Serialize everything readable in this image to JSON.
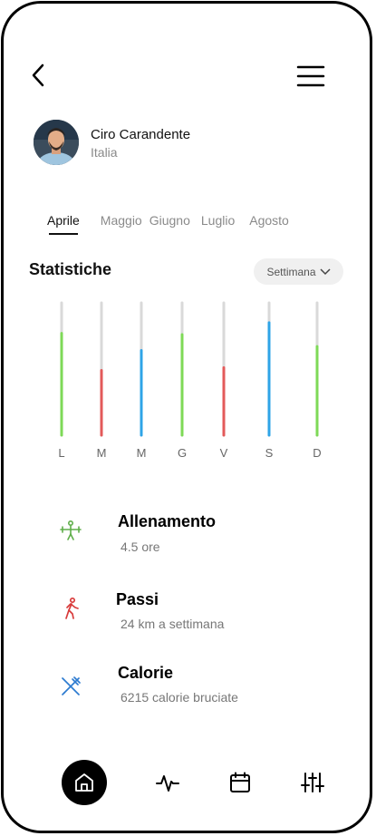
{
  "profile": {
    "name": "Ciro Carandente",
    "country": "Italia"
  },
  "months": [
    {
      "label": "Aprile",
      "active": true
    },
    {
      "label": "Maggio",
      "active": false
    },
    {
      "label": "Giugno",
      "active": false
    },
    {
      "label": "Luglio",
      "active": false
    },
    {
      "label": "Agosto",
      "active": false
    }
  ],
  "stats": {
    "title": "Statistiche",
    "period_label": "Settimana"
  },
  "chart_data": {
    "type": "bar",
    "categories": [
      "L",
      "M",
      "M",
      "G",
      "V",
      "S",
      "D"
    ],
    "values": [
      0.77,
      0.49,
      0.64,
      0.76,
      0.51,
      0.85,
      0.67
    ],
    "colors": [
      "#7ed957",
      "#e35a5a",
      "#2fa4e7",
      "#7ed957",
      "#e35a5a",
      "#2fa4e7",
      "#7ed957"
    ],
    "track_color": "#d9d9d9"
  },
  "activities": [
    {
      "title": "Allenamento",
      "subtitle": "4.5 ore",
      "icon": "fitness-icon",
      "tile_color": "#d8f3c9",
      "icon_color": "#5fae4a"
    },
    {
      "title": "Passi",
      "subtitle": "24 km a settimana",
      "icon": "walking-icon",
      "tile_color": "#f8cfcf",
      "icon_color": "#d83a3a"
    },
    {
      "title": "Calorie",
      "subtitle": "6215 calorie bruciate",
      "icon": "fork-knife-icon",
      "tile_color": "#cbe7fb",
      "icon_color": "#2d7bd0"
    }
  ],
  "nav": [
    "home-icon",
    "activity-icon",
    "calendar-icon",
    "sliders-icon"
  ]
}
